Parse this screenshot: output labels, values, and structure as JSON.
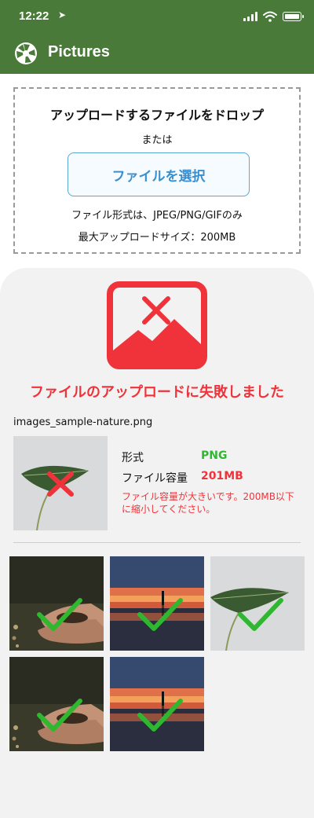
{
  "status_bar": {
    "time": "12:22"
  },
  "app": {
    "title": "Pictures"
  },
  "dropzone": {
    "title": "アップロードするファイルをドロップ",
    "or_text": "または",
    "button_label": "ファイルを選択",
    "format_note": "ファイル形式は、JPEG/PNG/GIFのみ",
    "size_note": "最大アップロードサイズ：200MB"
  },
  "result": {
    "error_title": "ファイルのアップロードに失敗しました",
    "filename": "images_sample-nature.png",
    "format_label": "形式",
    "format_value": "PNG",
    "size_label": "ファイル容量",
    "size_value": "201MB",
    "message": "ファイル容量が大きいです。200MB以下に縮小してください。"
  },
  "colors": {
    "header": "#4a7a3a",
    "error": "#f0333a",
    "success": "#2fb82f",
    "link": "#3a8fcf"
  },
  "gallery": [
    {
      "image": "hands-with-soil",
      "status": "check-icon"
    },
    {
      "image": "sunset-reflection",
      "status": "check-icon"
    },
    {
      "image": "leaf-on-stem",
      "status": "check-icon"
    },
    {
      "image": "hands-with-soil",
      "status": "check-icon"
    },
    {
      "image": "sunset-reflection",
      "status": "check-icon"
    }
  ]
}
